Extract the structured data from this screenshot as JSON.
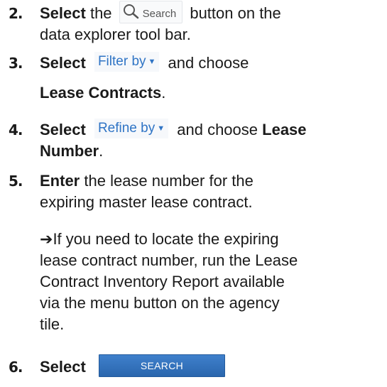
{
  "steps": [
    {
      "number": "2.",
      "verb": "Select",
      "before": "the",
      "button": {
        "icon": "search-icon",
        "label": "Search"
      },
      "after_line1": "button on the",
      "line2": "data explorer tool bar."
    },
    {
      "number": "3.",
      "verb": "Select",
      "dropdown": "Filter by",
      "after": "and choose",
      "choice": "Lease Contracts",
      "tail": "."
    },
    {
      "number": "4.",
      "verb": "Select",
      "dropdown": "Refine by",
      "after": "and choose",
      "choice1": "Lease",
      "choice2": "Number",
      "tail": "."
    },
    {
      "number": "5.",
      "verb": "Enter",
      "line1": "the lease number for the",
      "line2": "expiring master lease contract.",
      "note_arrow": "➔",
      "note_lines": [
        "If you need to locate the expiring",
        "lease contract number, run the Lease",
        "Contract Inventory Report available",
        "via the menu button on the agency",
        "tile."
      ]
    },
    {
      "number": "6.",
      "verb": "Select",
      "button_label": "SEARCH"
    }
  ],
  "colors": {
    "link_blue": "#2f74c5",
    "button_blue": "#336fb8"
  }
}
